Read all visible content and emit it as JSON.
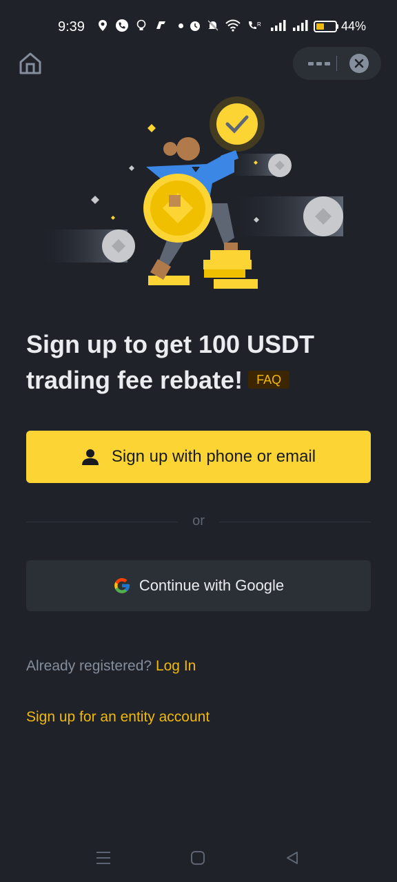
{
  "status_bar": {
    "time": "9:39",
    "battery_text": "44%",
    "battery_level": 0.44,
    "icons": [
      "location-icon",
      "phone-icon",
      "bulb-icon",
      "app-icon",
      "dot-icon",
      "alarm-icon",
      "mute-icon",
      "wifi-icon",
      "volte-icon",
      "signal-icon",
      "signal-icon"
    ]
  },
  "header": {
    "home_icon": "home-icon",
    "more_icon": "more-icon",
    "close_icon": "close-icon"
  },
  "hero": {
    "headline": "Sign up to get 100 USDT trading fee rebate!",
    "faq_label": "FAQ"
  },
  "actions": {
    "signup_label": "Sign up with phone or email",
    "divider_text": "or",
    "google_label": "Continue with Google"
  },
  "footer_links": {
    "already_text": "Already registered?",
    "login_label": "Log In",
    "entity_label": "Sign up for an entity account"
  },
  "colors": {
    "background": "#1f2229",
    "accent": "#fcd535",
    "link": "#f0b90b",
    "secondary_button": "#2b2f36"
  },
  "nav_bar": {
    "icons": [
      "menu-icon",
      "home-square-icon",
      "back-icon"
    ]
  }
}
